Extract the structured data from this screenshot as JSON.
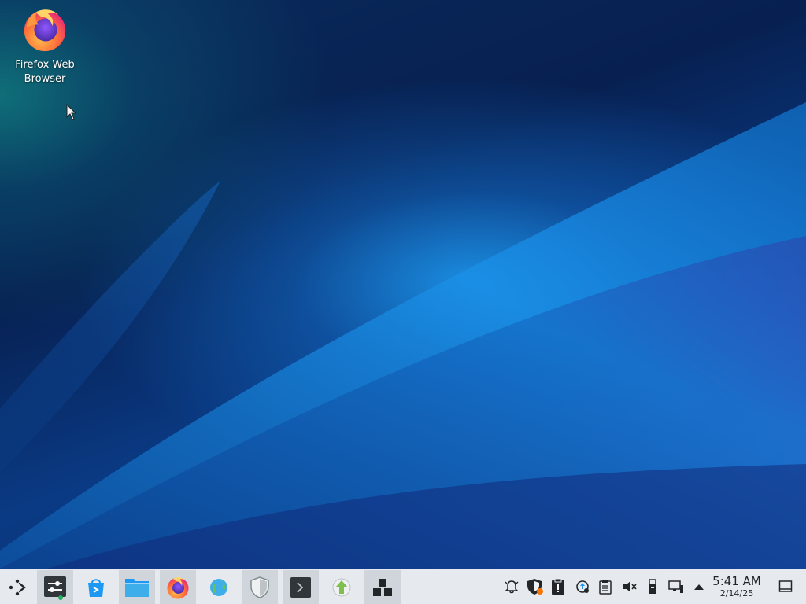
{
  "desktop": {
    "icons": [
      {
        "label": "Firefox Web Browser",
        "icon": "firefox-icon"
      }
    ]
  },
  "taskbar": {
    "launcher_icon": "app-launcher-icon",
    "tasks": [
      {
        "icon": "system-settings-icon"
      },
      {
        "icon": "discover-store-icon"
      },
      {
        "icon": "file-manager-icon"
      },
      {
        "icon": "firefox-icon"
      },
      {
        "icon": "globe-browser-icon"
      },
      {
        "icon": "security-shield-icon"
      },
      {
        "icon": "terminal-icon"
      },
      {
        "icon": "update-arrow-icon"
      },
      {
        "icon": "package-blocks-icon"
      }
    ],
    "tray": [
      "notifications-bell-icon",
      "security-status-icon",
      "clipboard-alert-icon",
      "updates-icon",
      "clipboard-icon",
      "volume-muted-icon",
      "usb-device-icon",
      "network-wired-icon",
      "expand-tray-icon"
    ],
    "clock": {
      "time": "5:41 AM",
      "date": "2/14/25"
    },
    "show_desktop_icon": "show-desktop-icon"
  },
  "colors": {
    "panel": "#e6e9ed",
    "accent": "#3daee9",
    "wallpaper_blue": "#0a3a84",
    "wallpaper_purple": "#8a1db0"
  }
}
